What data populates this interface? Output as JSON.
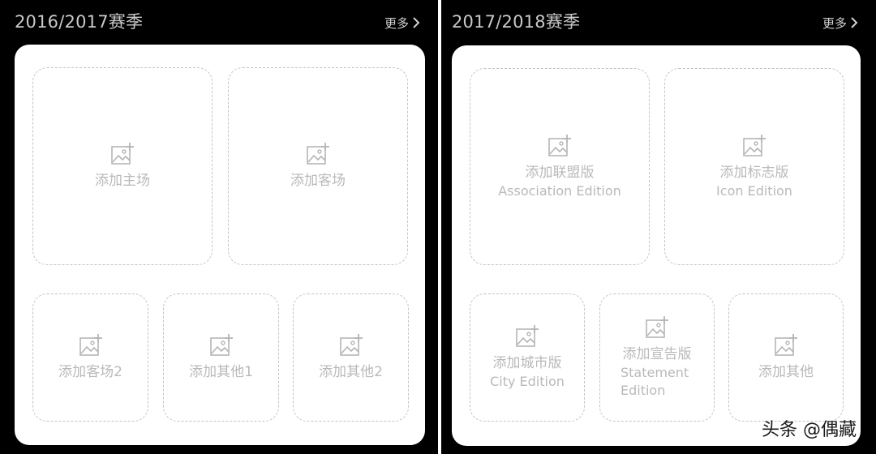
{
  "left": {
    "title": "2016/2017赛季",
    "more": "更多",
    "slots": [
      {
        "label": "添加主场"
      },
      {
        "label": "添加客场"
      },
      {
        "label": "添加客场2"
      },
      {
        "label": "添加其他1"
      },
      {
        "label": "添加其他2"
      }
    ]
  },
  "right": {
    "title": "2017/2018赛季",
    "more": "更多",
    "slots": [
      {
        "label": "添加联盟版",
        "sub": "Association Edition"
      },
      {
        "label": "添加标志版",
        "sub": "Icon Edition"
      },
      {
        "label": "添加城市版",
        "sub": "City Edition"
      },
      {
        "label": "添加宣告版",
        "sub": "Statement Edition"
      },
      {
        "label": "添加其他"
      }
    ]
  },
  "watermark": "头条 @偶藏",
  "colors": {
    "background": "#000000",
    "card": "#ffffff",
    "placeholder_text": "#b9b9b9",
    "dashed_border": "#c4c4c4",
    "header_text": "#c9c9c9"
  },
  "icons": {
    "slot": "add-image-icon",
    "more": "chevron-right-icon"
  }
}
